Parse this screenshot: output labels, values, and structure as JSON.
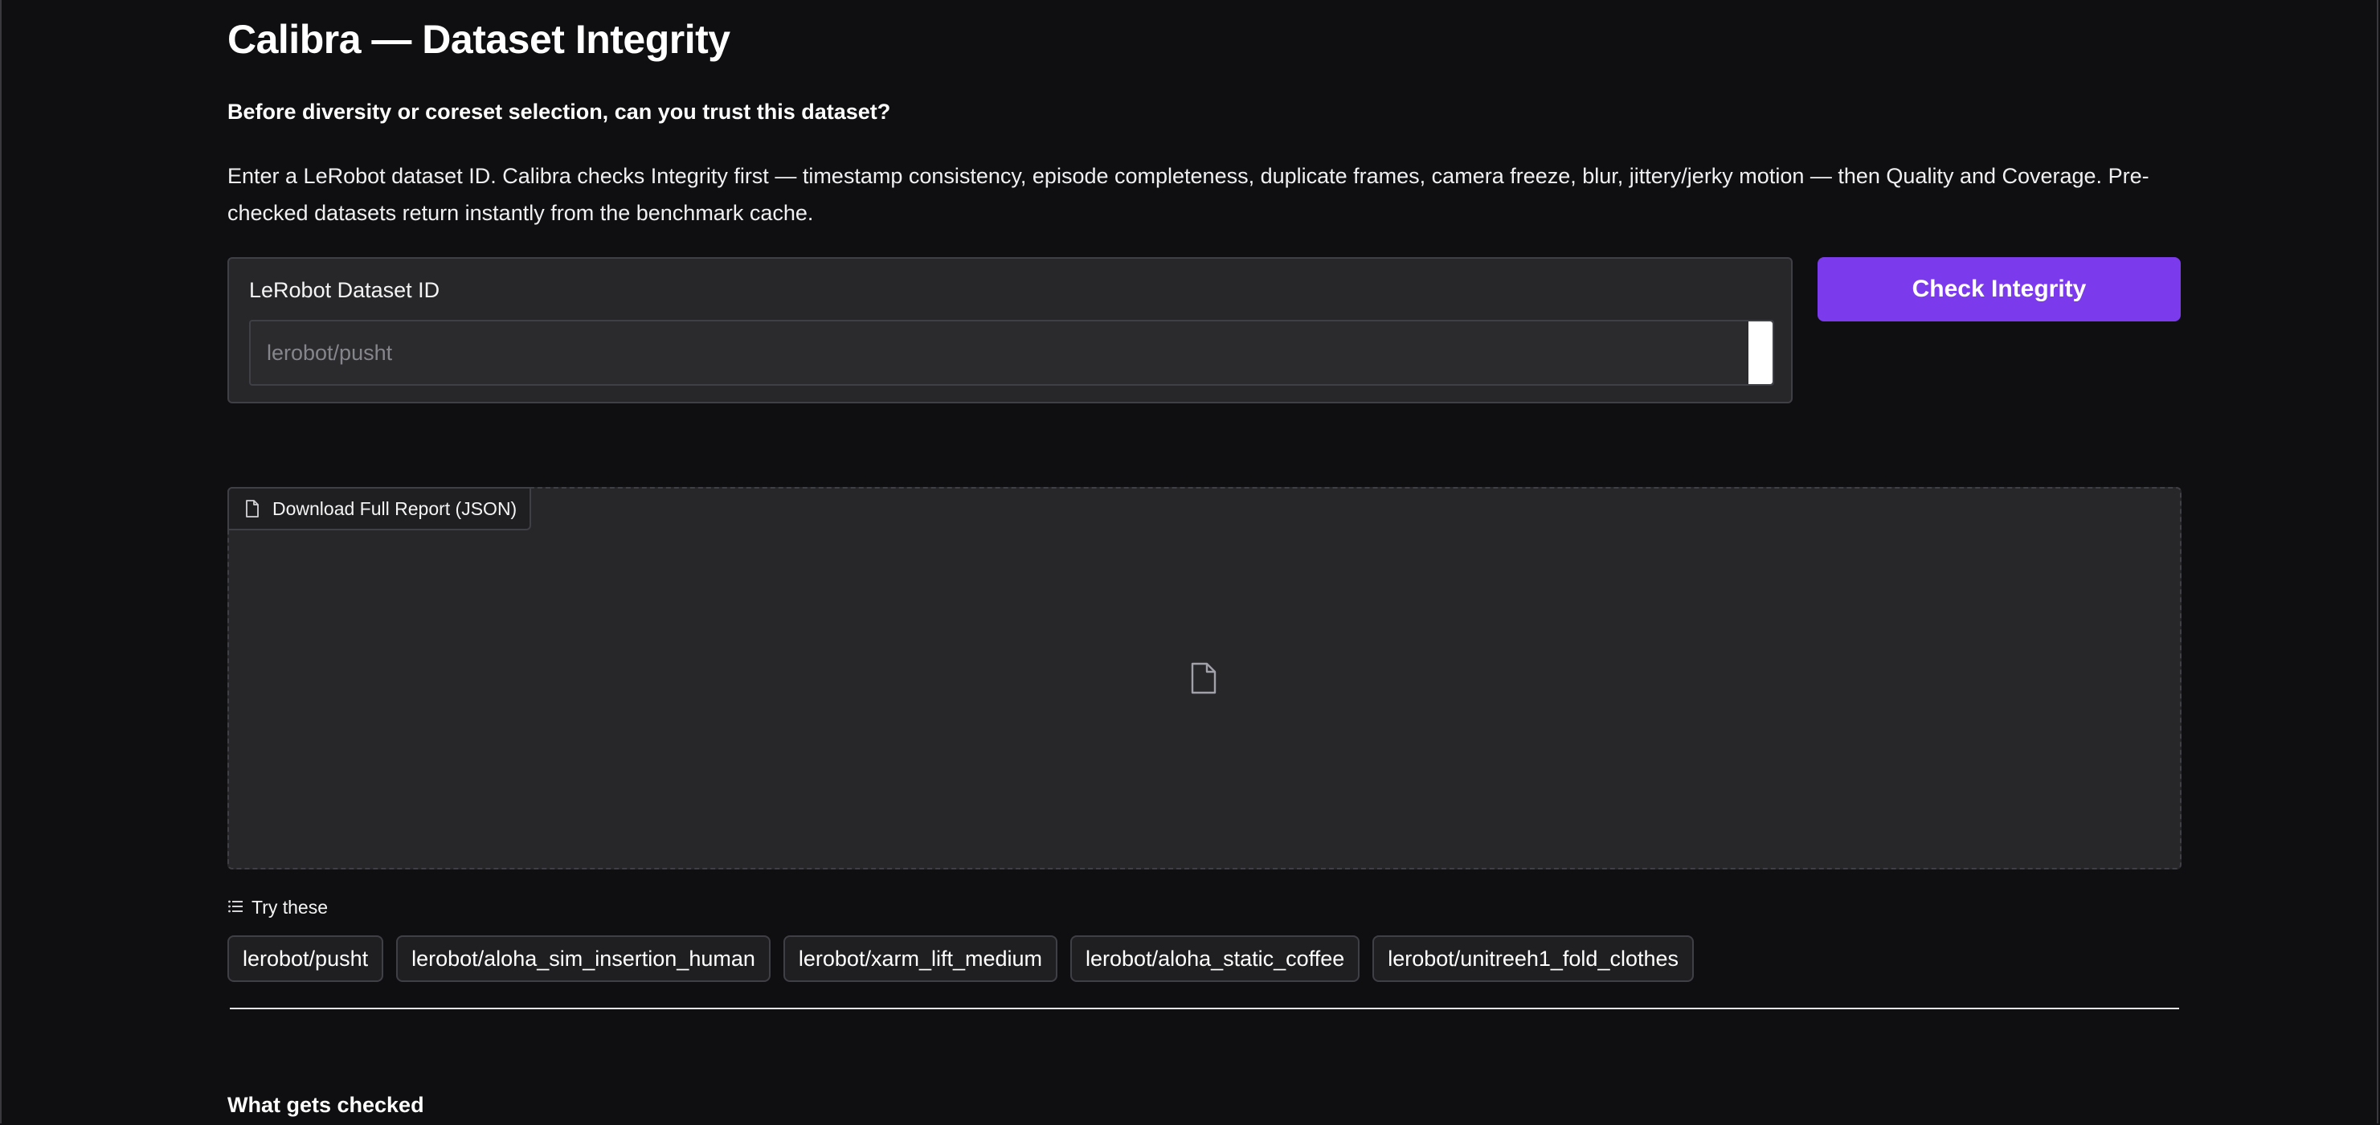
{
  "page": {
    "title": "Calibra — Dataset Integrity",
    "subtitle": "Before diversity or coreset selection, can you trust this dataset?",
    "description": "Enter a LeRobot dataset ID. Calibra checks Integrity first — timestamp consistency, episode completeness, duplicate frames, camera freeze, blur, jittery/jerky motion — then Quality and Coverage. Pre-checked datasets return instantly from the benchmark cache."
  },
  "dataset_input": {
    "label": "LeRobot Dataset ID",
    "value": "",
    "placeholder": "lerobot/pusht"
  },
  "check_button": {
    "label": "Check Integrity"
  },
  "report_file": {
    "download_label": "Download Full Report (JSON)",
    "icon": "file-icon"
  },
  "examples": {
    "label": "Try these",
    "icon": "list-icon",
    "items": [
      "lerobot/pusht",
      "lerobot/aloha_sim_insertion_human",
      "lerobot/xarm_lift_medium",
      "lerobot/aloha_static_coffee",
      "lerobot/unitreeh1_fold_clothes"
    ]
  },
  "section": {
    "what_gets_checked": "What gets checked"
  },
  "colors": {
    "background": "#0f0f11",
    "panel": "#27272a",
    "border": "#3f3f46",
    "accent": "#7c3aed"
  }
}
